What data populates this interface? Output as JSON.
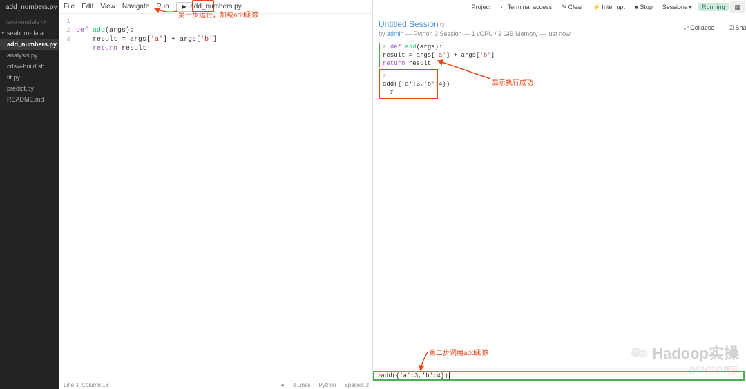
{
  "sidebar": {
    "open_file": "add_numbers.py",
    "section": "land-models",
    "folder": "seaborn-data",
    "items": [
      "add_numbers.py",
      "analysis.py",
      "cdsw-build.sh",
      "fit.py",
      "predict.py",
      "README.md"
    ]
  },
  "menubar": {
    "items": [
      "File",
      "Edit",
      "View",
      "Navigate",
      "Run"
    ],
    "run_icon": "▶",
    "filename": "add_numbers.py"
  },
  "code": {
    "lines": [
      "1",
      "2",
      "3"
    ],
    "l1_def": "def",
    "l1_fn": "add",
    "l1_rest": "(args):",
    "l2a": "    result = args[",
    "l2s1": "'a'",
    "l2b": "] + args[",
    "l2s2": "'b'",
    "l2c": "]",
    "l3_kw": "    return",
    "l3_rest": " result"
  },
  "statusbar": {
    "pos": "Line 3, Column 18",
    "dot": "●",
    "lines": "3 Lines",
    "lang": "Python",
    "spaces": "Spaces: 2"
  },
  "toolbar": {
    "project": "Project",
    "terminal": "Terminal access",
    "clear": "Clear",
    "interrupt": "Interrupt",
    "stop": "Stop",
    "sessions": "Sessions",
    "status": "Running"
  },
  "session": {
    "title": "Untitled Session",
    "by": "by ",
    "user": "admin",
    "meta": " — Python 3 Session — 1 vCPU / 2 GiB Memory — just now",
    "code_l1_def": "def",
    "code_l1_fn": " add",
    "code_l1_rest": "(args):",
    "code_l2a": "    result = args[",
    "code_l2s1": "'a'",
    "code_l2b": "] + args[",
    "code_l2s2": "'b'",
    "code_l2c": "]",
    "code_l3_kw": "    return",
    "code_l3_rest": " result",
    "call": "add({'a':3,'b':4})",
    "result": "7",
    "input": "add({'a':3,'b':4})"
  },
  "annotations": {
    "a1": "第一步运行，加载add函数",
    "a2": "显示执行成功",
    "a3": "第二步调用add函数"
  },
  "watermark": {
    "top": "Hadoop实操",
    "bot": "@51CTO博客"
  }
}
